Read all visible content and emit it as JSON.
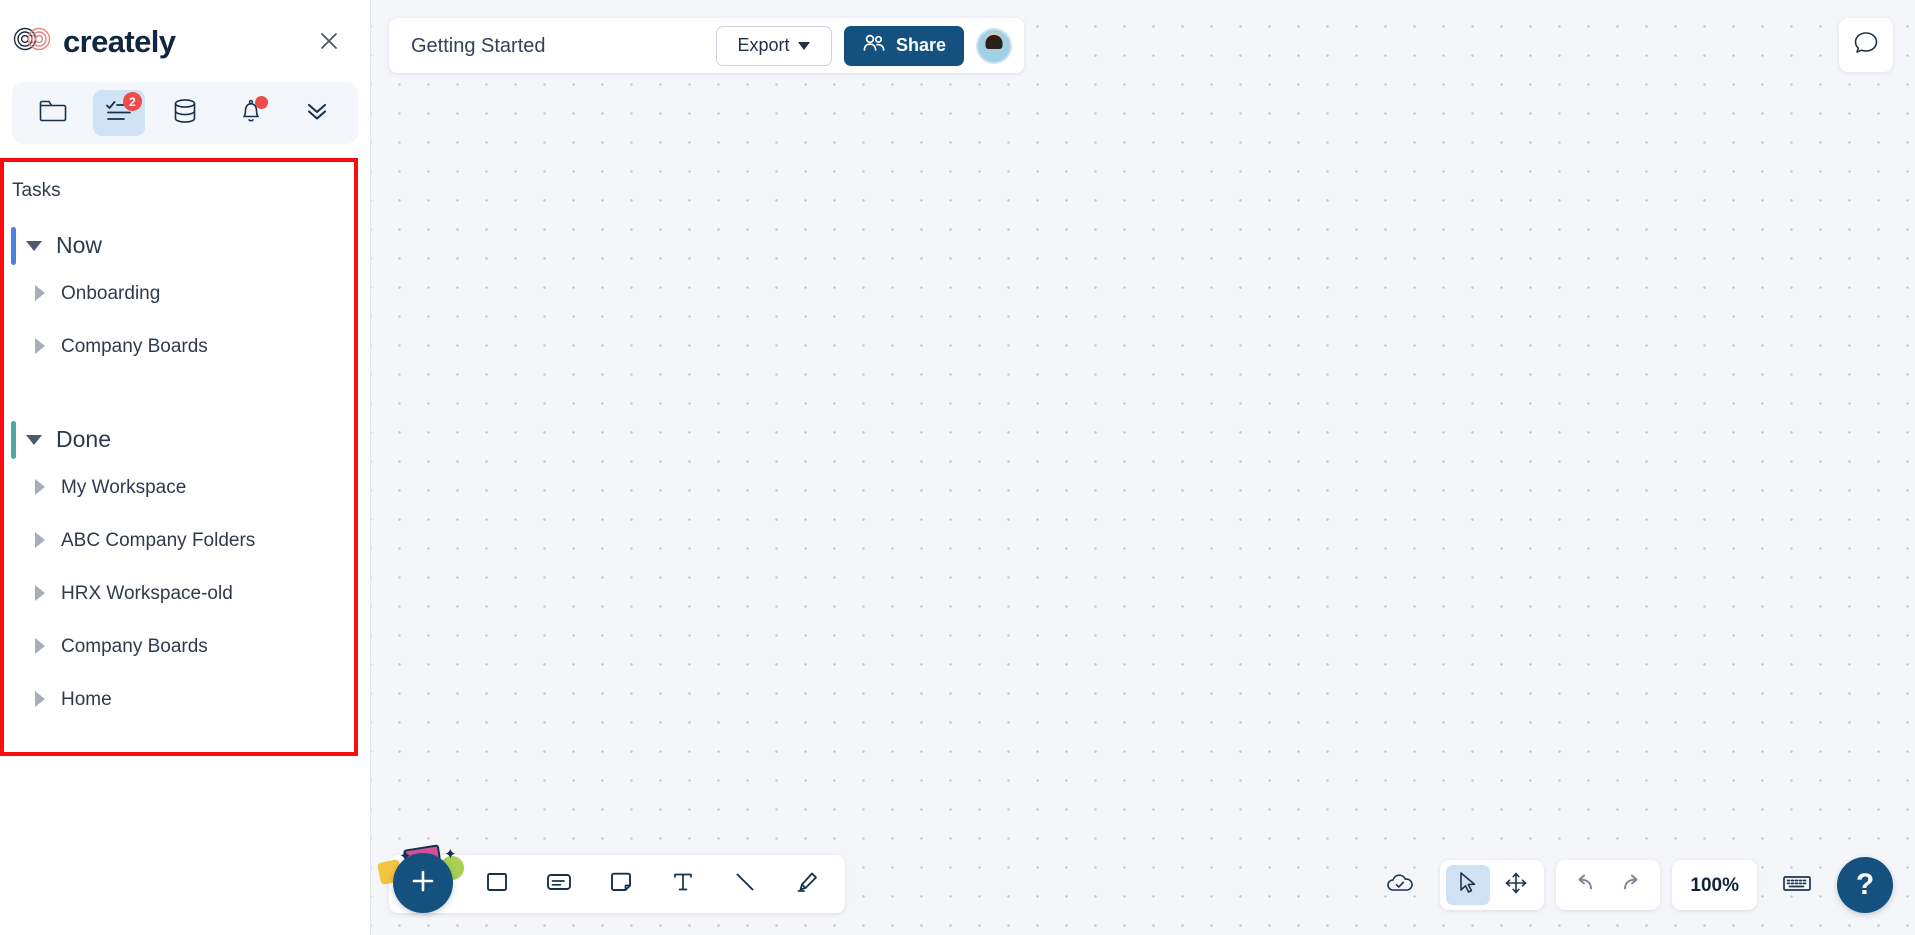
{
  "brand": {
    "name": "creately",
    "logo_icon": "creately-infinity-logo",
    "close_icon": "close-icon"
  },
  "icon_rail": {
    "items": [
      {
        "icon": "folder-icon",
        "name": "folders",
        "active": false,
        "badge": null,
        "dot": false
      },
      {
        "icon": "task-list-icon",
        "name": "tasks",
        "active": true,
        "badge": "2",
        "dot": false
      },
      {
        "icon": "database-icon",
        "name": "database",
        "active": false,
        "badge": null,
        "dot": false
      },
      {
        "icon": "bell-icon",
        "name": "notifications",
        "active": false,
        "badge": null,
        "dot": true
      },
      {
        "icon": "chevron-double-down-icon",
        "name": "more",
        "active": false,
        "badge": null,
        "dot": false
      }
    ]
  },
  "tasks_panel": {
    "title": "Tasks",
    "highlight_color": "#fb0d0d",
    "groups": [
      {
        "label": "Now",
        "accent_color": "#4f7fe0",
        "expanded": true,
        "items": [
          {
            "label": "Onboarding"
          },
          {
            "label": "Company Boards"
          }
        ]
      },
      {
        "label": "Done",
        "accent_color": "#4fa9a0",
        "expanded": true,
        "items": [
          {
            "label": "My Workspace"
          },
          {
            "label": "ABC Company Folders"
          },
          {
            "label": "HRX Workspace-old"
          },
          {
            "label": "Company Boards"
          },
          {
            "label": "Home"
          }
        ]
      }
    ]
  },
  "doc_bar": {
    "title": "Getting Started",
    "export_label": "Export",
    "export_caret_icon": "caret-down-icon",
    "share_label": "Share",
    "share_icon": "people-icon",
    "share_color": "#14517f",
    "avatar_name": "user-avatar"
  },
  "canvas": {
    "chat_icon": "chat-bubble-icon"
  },
  "tool_dock": {
    "add_icon": "plus-icon",
    "tools": [
      {
        "icon": "square-shape-icon",
        "name": "shape-tool"
      },
      {
        "icon": "card-icon",
        "name": "card-tool"
      },
      {
        "icon": "sticky-note-icon",
        "name": "note-tool"
      },
      {
        "icon": "text-icon",
        "name": "text-tool"
      },
      {
        "icon": "line-icon",
        "name": "line-tool"
      },
      {
        "icon": "marker-pen-icon",
        "name": "pen-tool"
      }
    ]
  },
  "right_dock": {
    "save_icon": "cloud-check-icon",
    "select_icon": "cursor-arrow-icon",
    "pan_icon": "move-arrows-icon",
    "undo_icon": "undo-icon",
    "redo_icon": "redo-icon",
    "zoom_level": "100%",
    "keyboard_icon": "keyboard-icon",
    "help_label": "?"
  }
}
